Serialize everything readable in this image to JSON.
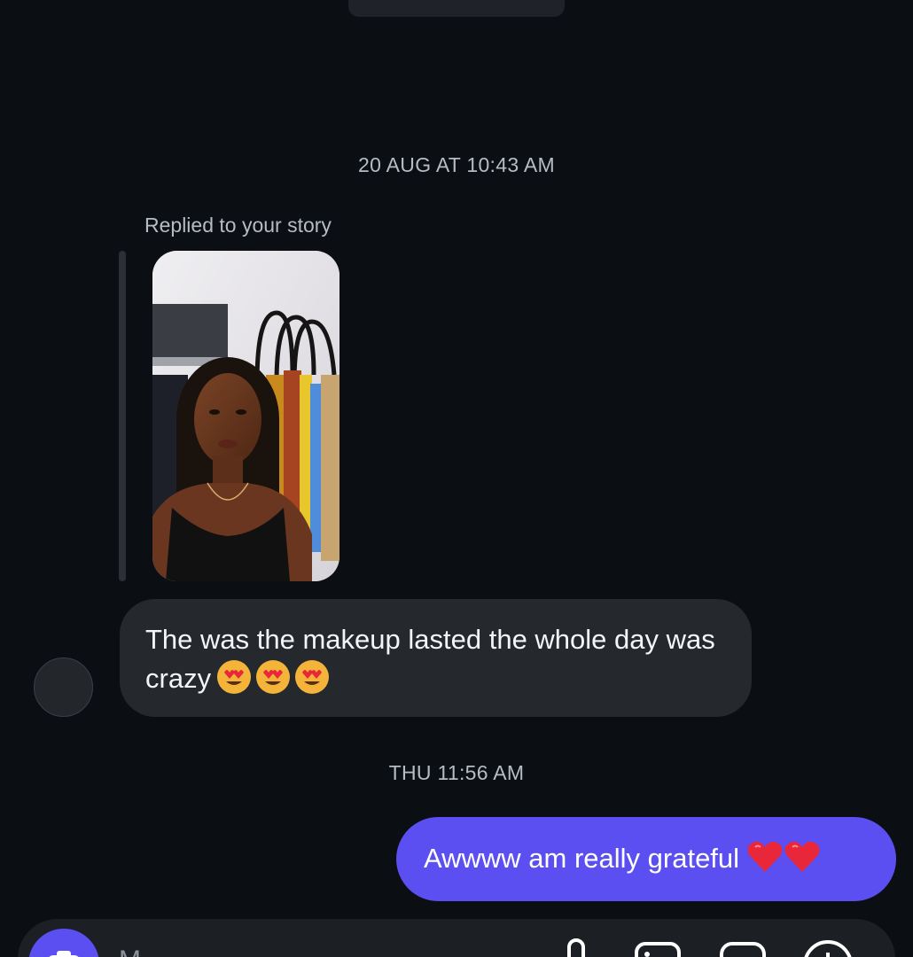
{
  "thread": {
    "timestamp_1": "20 AUG AT 10:43 AM",
    "reply_caption": "Replied to your story",
    "incoming_message": "The was the makeup lasted the whole day was crazy",
    "incoming_emoji": "smiling-face-with-heart-eyes",
    "timestamp_2": "THU 11:56 AM",
    "outgoing_message": "Awwww am really grateful",
    "outgoing_emoji": "red-heart"
  },
  "composer": {
    "placeholder": "M"
  },
  "colors": {
    "background": "#0b0f13",
    "incoming_bubble": "#25282d",
    "outgoing_bubble": "#5b4ff2",
    "muted_text": "#b7bcc4"
  },
  "icons": {
    "camera": "camera-icon",
    "microphone": "microphone-icon",
    "gallery": "gallery-icon",
    "sticker": "sticker-icon",
    "add": "plus-circle-icon"
  }
}
